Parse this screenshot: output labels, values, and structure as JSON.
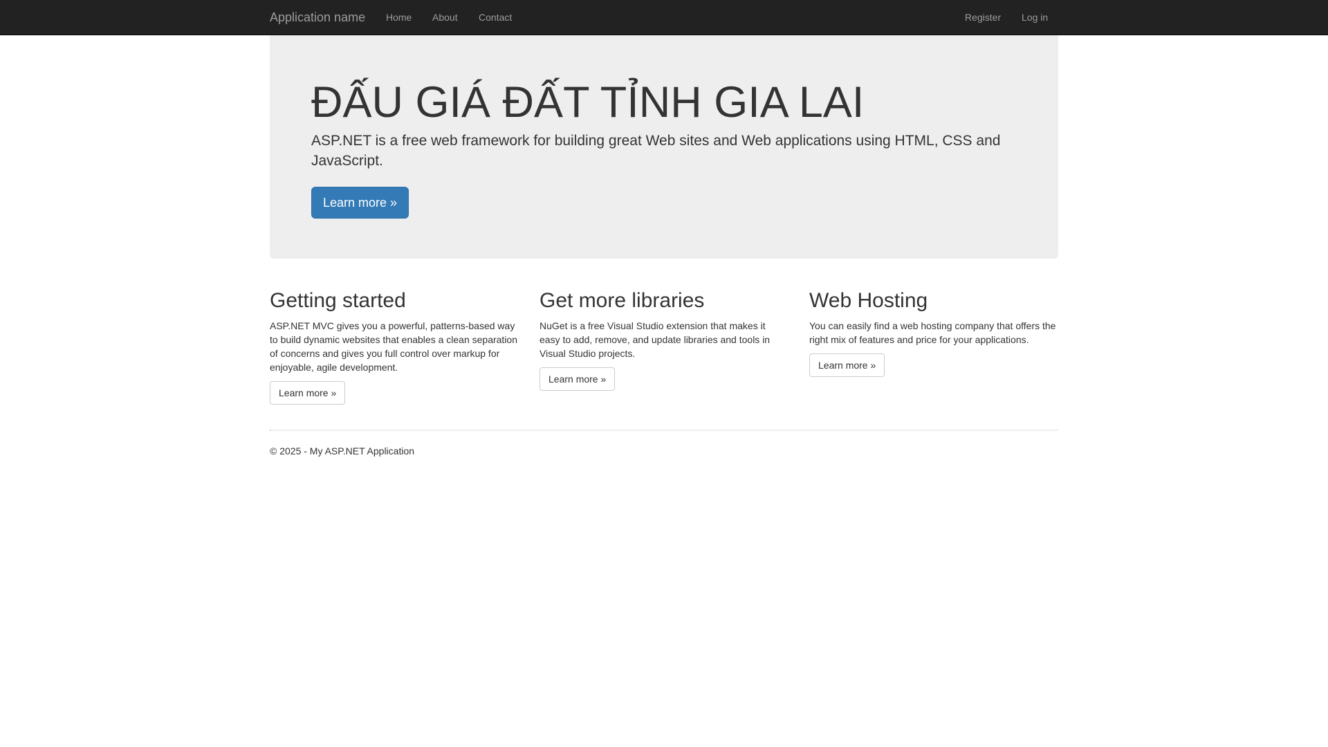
{
  "navbar": {
    "brand": "Application name",
    "links": [
      "Home",
      "About",
      "Contact"
    ],
    "right_links": [
      "Register",
      "Log in"
    ],
    "background": "#222222",
    "link_color": "#9d9d9d"
  },
  "jumbotron": {
    "title": "ĐẤU GIÁ ĐẤT TỈNH GIA LAI",
    "lead": "ASP.NET is a free web framework for building great Web sites and Web applications using HTML, CSS and JavaScript.",
    "button_label": "Learn more »",
    "button_color": "#337ab7",
    "background": "#eeeeee"
  },
  "columns": [
    {
      "heading": "Getting started",
      "text": "ASP.NET MVC gives you a powerful, patterns-based way to build dynamic websites that enables a clean separation of concerns and gives you full control over markup for enjoyable, agile development.",
      "button_label": "Learn more »"
    },
    {
      "heading": "Get more libraries",
      "text": "NuGet is a free Visual Studio extension that makes it easy to add, remove, and update libraries and tools in Visual Studio projects.",
      "button_label": "Learn more »"
    },
    {
      "heading": "Web Hosting",
      "text": "You can easily find a web hosting company that offers the right mix of features and price for your applications.",
      "button_label": "Learn more »"
    }
  ],
  "footer": {
    "text": "© 2025 - My ASP.NET Application"
  }
}
